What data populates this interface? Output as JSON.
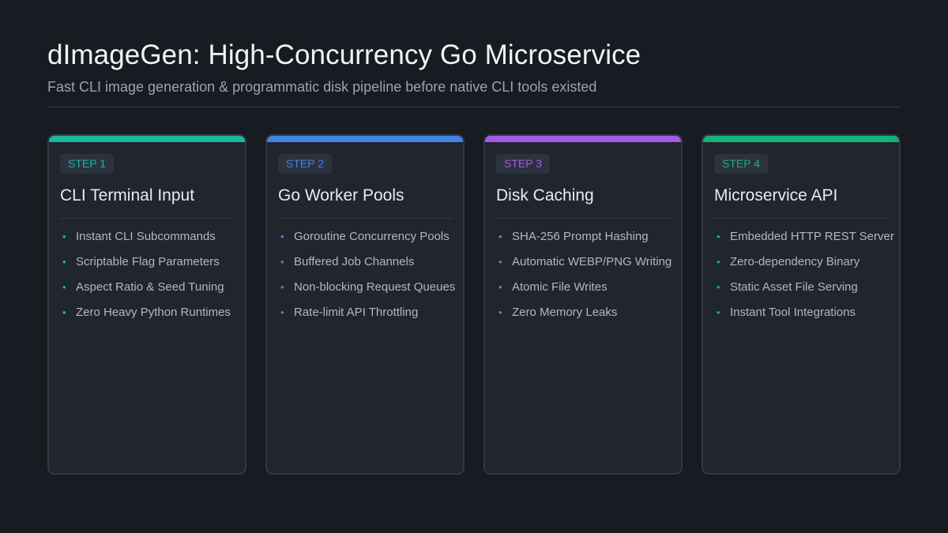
{
  "header": {
    "title": "dImageGen: High-Concurrency Go Microservice",
    "subtitle": "Fast CLI image generation & programmatic disk pipeline before native CLI tools existed"
  },
  "cards": [
    {
      "step": "STEP 1",
      "title": "CLI Terminal Input",
      "color": "#17b8a0",
      "items": [
        "Instant CLI Subcommands",
        "Scriptable Flag Parameters",
        "Aspect Ratio & Seed Tuning",
        "Zero Heavy Python Runtimes"
      ]
    },
    {
      "step": "STEP 2",
      "title": "Go Worker Pools",
      "color": "#3f82e8",
      "items": [
        "Goroutine Concurrency Pools",
        "Buffered Job Channels",
        "Non-blocking Request Queues",
        "Rate-limit API Throttling"
      ]
    },
    {
      "step": "STEP 3",
      "title": "Disk Caching",
      "color": "#a35ae8",
      "items": [
        "SHA-256 Prompt Hashing",
        "Automatic WEBP/PNG Writing",
        "Atomic File Writes",
        "Zero Memory Leaks"
      ]
    },
    {
      "step": "STEP 4",
      "title": "Microservice API",
      "color": "#15b377",
      "items": [
        "Embedded HTTP REST Server",
        "Zero-dependency Binary",
        "Static Asset File Serving",
        "Instant Tool Integrations"
      ]
    }
  ]
}
